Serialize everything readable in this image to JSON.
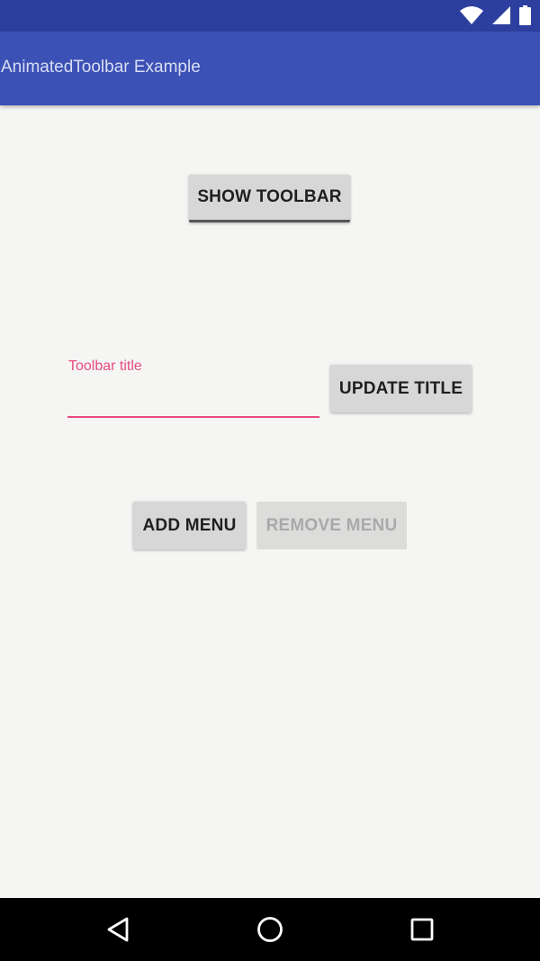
{
  "app_bar": {
    "title": "AnimatedToolbar Example",
    "color": "#3b51b5"
  },
  "status_bar": {
    "color": "#2d3f9e",
    "icons": [
      "wifi-icon",
      "signal-icon",
      "battery-icon"
    ]
  },
  "main": {
    "show_toolbar_button": "SHOW TOOLBAR",
    "title_field": {
      "label": "Toolbar title",
      "value": "",
      "accent_color": "#e84a80"
    },
    "update_title_button": "UPDATE TITLE",
    "add_menu_button": "ADD MENU",
    "remove_menu_button": "REMOVE MENU",
    "remove_menu_enabled": false
  },
  "nav_bar": {
    "buttons": [
      "back-icon",
      "home-icon",
      "recents-icon"
    ]
  }
}
